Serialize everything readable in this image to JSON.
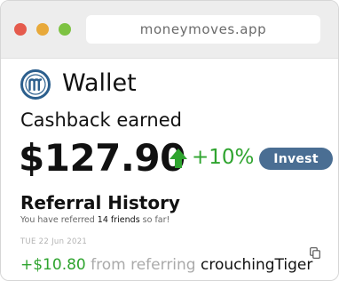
{
  "browser": {
    "url": "moneymoves.app"
  },
  "header": {
    "brand": "Wallet",
    "logo_icon": "moneymoves-m-logo-icon"
  },
  "cashback": {
    "label": "Cashback earned",
    "amount": "$127.90",
    "change": "+10%",
    "change_icon": "arrow-up-icon",
    "invest_label": "Invest"
  },
  "referral": {
    "title": "Referral History",
    "subtitle_prefix": "You have referred",
    "subtitle_count": "14 friends",
    "subtitle_suffix": "so far!",
    "entries": [
      {
        "date": "TUE 22 Jun 2021",
        "amount": "+$10.80",
        "text": "from referring",
        "user": "crouchingTiger"
      }
    ]
  },
  "colors": {
    "positive": "#2fa42f",
    "button": "#4a6e93",
    "logo": "#2c5f8d"
  }
}
